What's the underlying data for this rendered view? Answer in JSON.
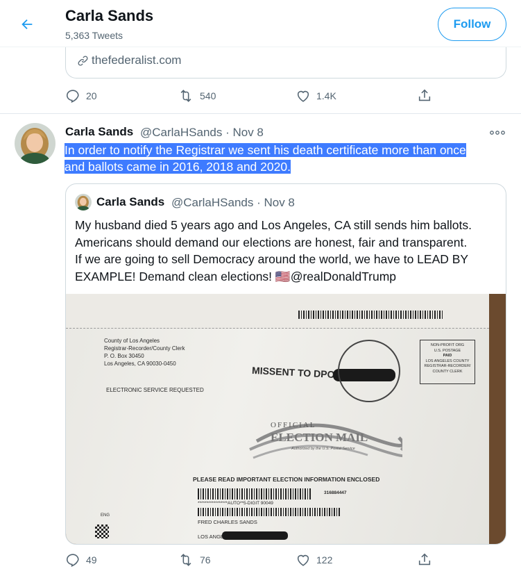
{
  "header": {
    "title": "Carla Sands",
    "tweet_count": "5,363 Tweets",
    "follow_label": "Follow"
  },
  "first_tweet": {
    "link_domain": "thefederalist.com",
    "replies": "20",
    "retweets": "540",
    "likes": "1.4K"
  },
  "tweet": {
    "name": "Carla Sands",
    "handle_date": "@CarlaHSands · Nov 8",
    "text_line1": "In order to notify the Registrar we sent his death certificate more than once",
    "text_line2": "and ballots came in 2016, 2018 and 2020.",
    "replies": "49",
    "retweets": "76",
    "likes": "122"
  },
  "quote": {
    "name": "Carla Sands",
    "handle_date": "@CarlaHSands · Nov 8",
    "text_line1": "My husband died 5 years ago and Los Angeles, CA still sends him ballots.",
    "text_line2": "Americans should demand our elections are honest, fair and transparent.",
    "text_line3": "If we are going to sell Democracy around the world, we have to LEAD BY",
    "text_line4": "EXAMPLE! Demand clean elections!",
    "flag": "🇺🇸",
    "mention": "@realDonaldTrump"
  },
  "envelope": {
    "return_line1": "County of Los Angeles",
    "return_line2": "Registrar-Recorder/County Clerk",
    "return_line3": "P. O. Box 30450",
    "return_line4": "Los Angeles, CA 90030-0450",
    "service": "ELECTRONIC SERVICE REQUESTED",
    "missent": "MISSENT TO DPO",
    "postage1": "NON-PROFIT ORG",
    "postage2": "U.S. POSTAGE",
    "postage3": "PAID",
    "postage4": "LOS ANGELES COUNTY",
    "postage5": "REGISTRAR-RECORDER/",
    "postage6": "COUNTY CLERK",
    "official": "OFFICIAL",
    "election_mail": "ELECTION MAIL",
    "authorized": "Authorized by the U.S. Postal Service",
    "notice": "PLEASE READ IMPORTANT ELECTION INFORMATION ENCLOSED",
    "auto_line": "*****************AUTO**5-DIGIT 90049",
    "serial": "316884447",
    "addressee": "FRED CHARLES SANDS",
    "city": "LOS ANGE",
    "eng": "ENG"
  },
  "colors": {
    "accent": "#1d9bf0",
    "secondary_text": "#536471",
    "highlight": "#3e7bff"
  }
}
